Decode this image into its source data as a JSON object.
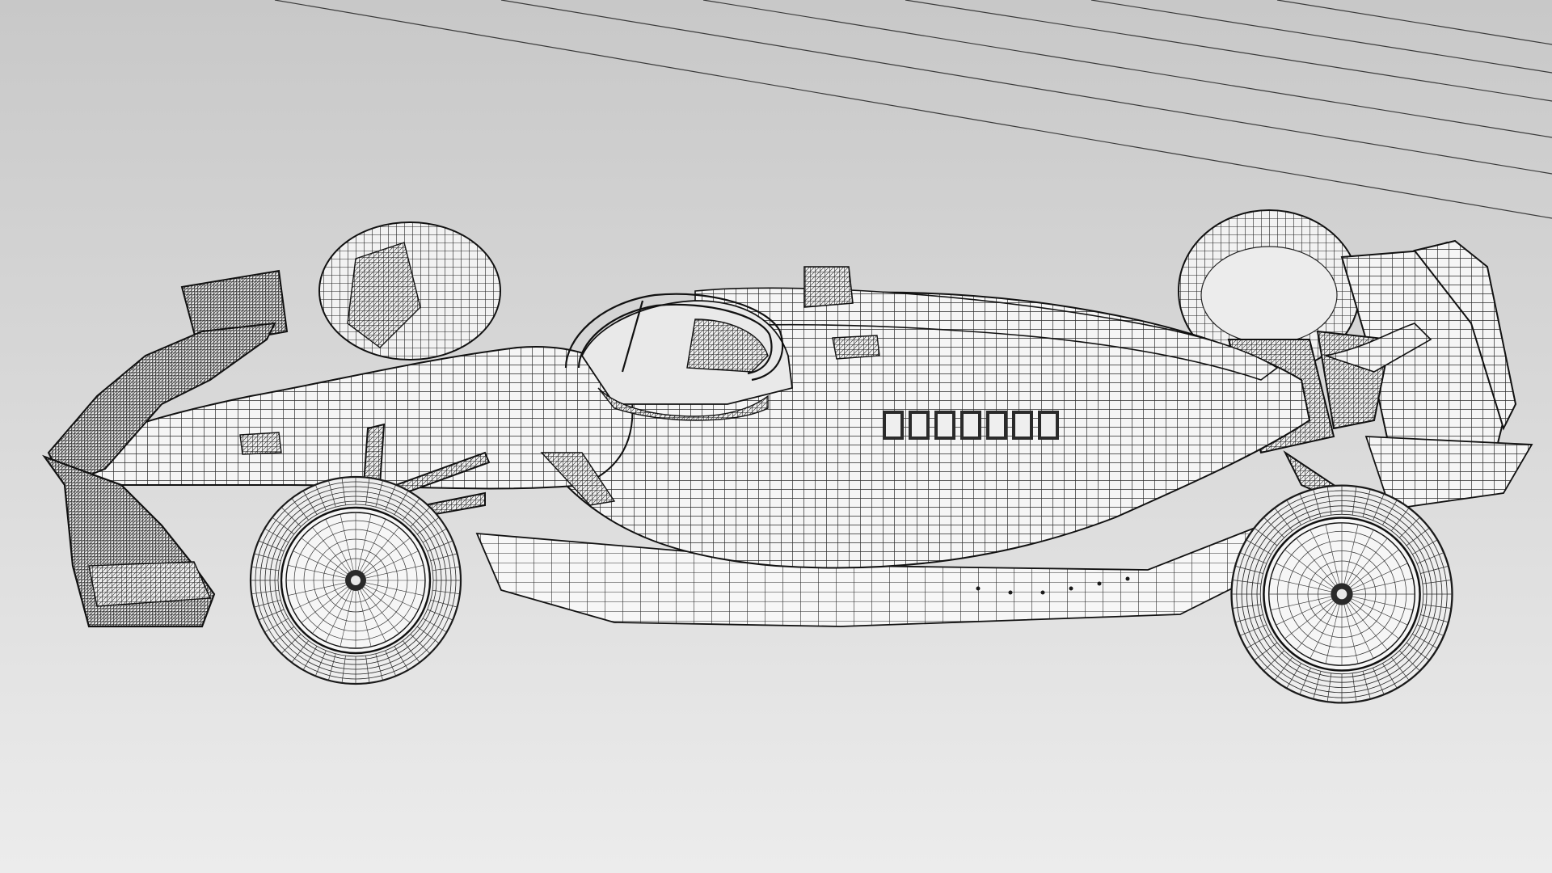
{
  "scene": {
    "subject": "formula-one-car-wireframe",
    "render_style": "wireframe-on-white",
    "background_color_top": "#c8c8c8",
    "background_color_bottom": "#ececec",
    "wire_color": "#1e1e1e",
    "surface_color": "#f4f4f4"
  }
}
